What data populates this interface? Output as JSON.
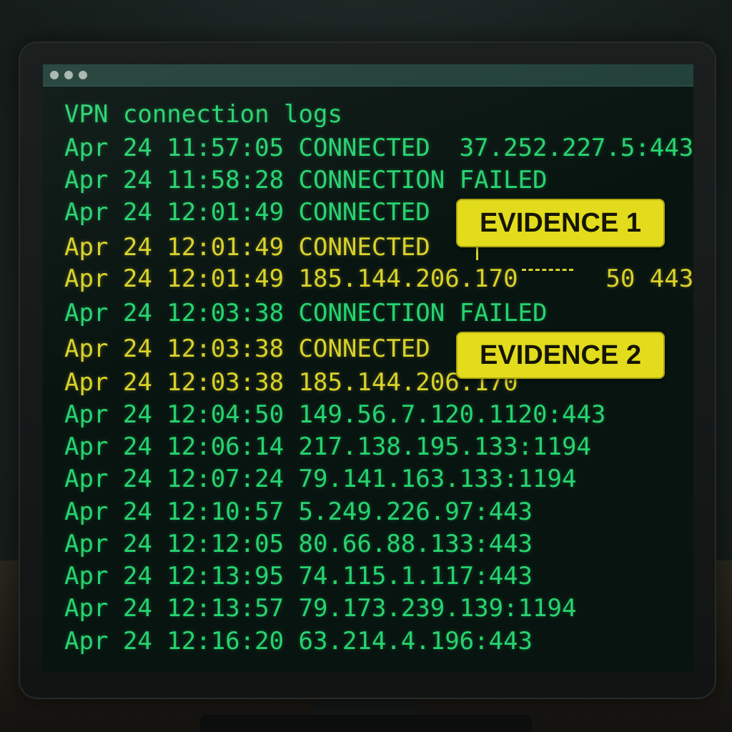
{
  "terminal": {
    "title": "VPN connection logs",
    "lines": [
      {
        "text": "Apr 24 11:57:05 CONNECTED  37.252.227.5:443",
        "highlight": false
      },
      {
        "text": "Apr 24 11:58:28 CONNECTION FAILED",
        "highlight": false
      },
      {
        "text": "Apr 24 12:01:49 CONNECTED",
        "highlight": false
      },
      {
        "text": "Apr 24 12:01:49 CONNECTED",
        "highlight": true
      },
      {
        "text": "Apr 24 12:01:49 185.144.206.170      50 443",
        "highlight": true
      },
      {
        "text": "Apr 24 12:03:38 CONNECTION FAILED",
        "highlight": false
      },
      {
        "text": "Apr 24 12:03:38 CONNECTED",
        "highlight": true
      },
      {
        "text": "Apr 24 12:03:38 185.144.206.170",
        "highlight": true
      },
      {
        "text": "Apr 24 12:04:50 149.56.7.120.1120:443",
        "highlight": false
      },
      {
        "text": "Apr 24 12:06:14 217.138.195.133:1194",
        "highlight": false
      },
      {
        "text": "Apr 24 12:07:24 79.141.163.133:1194",
        "highlight": false
      },
      {
        "text": "Apr 24 12:10:57 5.249.226.97:443",
        "highlight": false
      },
      {
        "text": "Apr 24 12:12:05 80.66.88.133:443",
        "highlight": false
      },
      {
        "text": "Apr 24 12:13:95 74.115.1.117:443",
        "highlight": false
      },
      {
        "text": "Apr 24 12:13:57 79.173.239.139:1194",
        "highlight": false
      },
      {
        "text": "Apr 24 12:16:20 63.214.4.196:443",
        "highlight": false
      }
    ]
  },
  "annotations": {
    "evidence_1": "EVIDENCE 1",
    "evidence_2": "EVIDENCE 2"
  },
  "colors": {
    "log_text": "#27d36f",
    "highlight_text": "#d9d12a",
    "badge_background": "#e2dc1c",
    "titlebar": "#203f37",
    "screen_background": "#081410"
  },
  "icons": {
    "window_controls": [
      "window-dot-icon",
      "window-dot-icon",
      "window-dot-icon"
    ]
  }
}
